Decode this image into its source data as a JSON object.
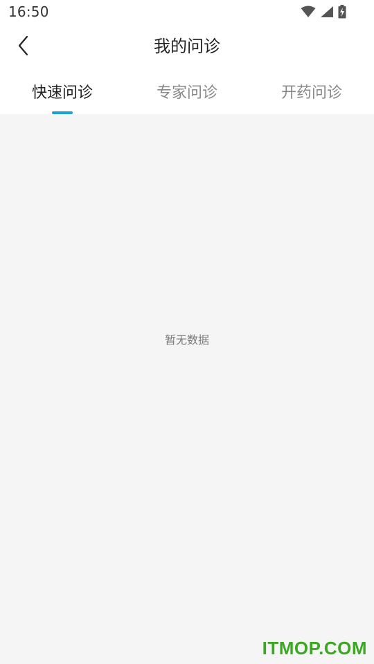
{
  "status_bar": {
    "time": "16:50",
    "icons": [
      "wifi-icon",
      "cellular-signal-icon",
      "battery-charging-icon"
    ]
  },
  "header": {
    "title": "我的问诊",
    "back_icon": "chevron-left-icon"
  },
  "tabs": [
    {
      "label": "快速问诊",
      "active": true
    },
    {
      "label": "专家问诊",
      "active": false
    },
    {
      "label": "开药问诊",
      "active": false
    }
  ],
  "content": {
    "empty_text": "暂无数据"
  },
  "watermark": {
    "text": "ITMOP.COM"
  },
  "colors": {
    "accent": "#1ba3d8",
    "background": "#f5f5f5",
    "watermark": "#3aa820"
  }
}
